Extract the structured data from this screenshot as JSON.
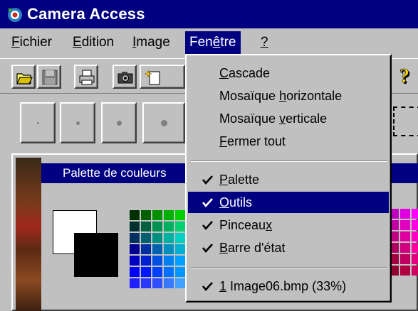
{
  "window": {
    "title": "Camera Access"
  },
  "menubar": {
    "items": [
      {
        "label_pre": "",
        "label_u": "F",
        "label_post": "ichier"
      },
      {
        "label_pre": "",
        "label_u": "E",
        "label_post": "dition"
      },
      {
        "label_pre": "",
        "label_u": "I",
        "label_post": "mage"
      },
      {
        "label_pre": "Fen",
        "label_u": "ê",
        "label_post": "tre"
      },
      {
        "label_pre": "",
        "label_u": "?",
        "label_post": ""
      }
    ],
    "active_index": 3
  },
  "palette": {
    "title": "Palette de couleurs"
  },
  "dropdown": {
    "items": [
      {
        "pre": "",
        "u": "C",
        "post": "ascade",
        "checked": false,
        "selected": false
      },
      {
        "pre": "Mosaïque ",
        "u": "h",
        "post": "orizontale",
        "checked": false,
        "selected": false
      },
      {
        "pre": "Mosaïque ",
        "u": "v",
        "post": "erticale",
        "checked": false,
        "selected": false
      },
      {
        "pre": "",
        "u": "F",
        "post": "ermer tout",
        "checked": false,
        "selected": false
      },
      {
        "pre": "",
        "u": "P",
        "post": "alette",
        "checked": true,
        "selected": false
      },
      {
        "pre": "",
        "u": "O",
        "post": "utils",
        "checked": true,
        "selected": true
      },
      {
        "pre": "Pinceau",
        "u": "x",
        "post": "",
        "checked": true,
        "selected": false
      },
      {
        "pre": "",
        "u": "B",
        "post": "arre d'état",
        "checked": true,
        "selected": false
      },
      {
        "pre": "",
        "u": "1",
        "post": " Image06.bmp (33%)",
        "checked": true,
        "selected": false
      }
    ]
  },
  "colors": {
    "titlebar": "#000080",
    "highlight": "#000080",
    "face": "#c0c0c0"
  }
}
